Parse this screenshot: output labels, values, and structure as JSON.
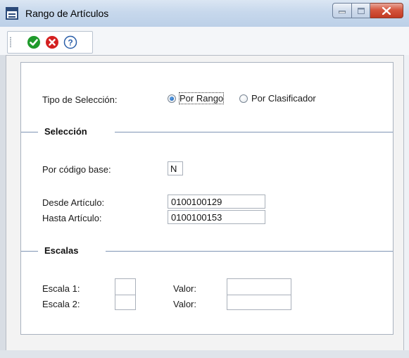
{
  "window": {
    "title": "Rango de Artículos",
    "buttons": {
      "minimize": "minimize-icon",
      "maximize": "maximize-icon",
      "close": "close-icon"
    }
  },
  "toolbar": {
    "icons": [
      "confirm-check-icon",
      "cancel-x-icon",
      "help-question-icon"
    ],
    "colors": {
      "confirm": "#1f9a2b",
      "cancel": "#d42020",
      "help": "#2a5ea8"
    }
  },
  "form": {
    "tipo_label": "Tipo de Selección:",
    "tipo_options": [
      {
        "label": "Por Rango",
        "selected": true
      },
      {
        "label": "Por Clasificador",
        "selected": false
      }
    ],
    "seleccion": {
      "title": "Selección",
      "codigo_base_label": "Por código base:",
      "codigo_base_value": "N",
      "desde_label": "Desde Artículo:",
      "desde_value": "0100100129",
      "hasta_label": "Hasta Artículo:",
      "hasta_value": "0100100153"
    },
    "escalas": {
      "title": "Escalas",
      "rows": [
        {
          "label": "Escala 1:",
          "value_label": "Valor:",
          "escala": "",
          "valor": ""
        },
        {
          "label": "Escala 2:",
          "value_label": "Valor:",
          "escala": "",
          "valor": ""
        }
      ]
    }
  }
}
